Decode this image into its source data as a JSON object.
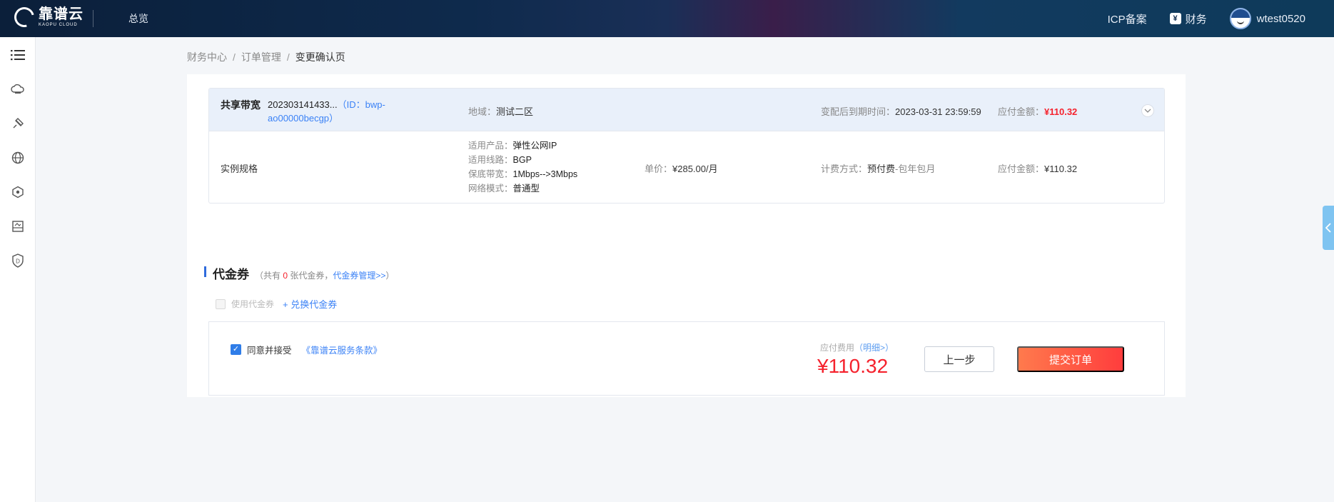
{
  "header": {
    "logo_cn": "靠谱云",
    "logo_en": "KAOPU CLOUD",
    "nav_overview": "总览",
    "icp": "ICP备案",
    "finance_icon": "¥",
    "finance": "财务",
    "username": "wtest0520"
  },
  "sidebar": {
    "icons": [
      "list-icon",
      "cloud-host-icon",
      "satellite-icon",
      "globe-icon",
      "network-node-icon",
      "storage-icon",
      "shield-d-icon"
    ]
  },
  "breadcrumb": {
    "items": [
      "财务中心",
      "订单管理",
      "变更确认页"
    ],
    "separator": "/"
  },
  "order": {
    "type": "共享带宽",
    "order_no": "202303141433...",
    "id_text": "（ID：bwp-ao00000becgp）",
    "region_label": "地域：",
    "region": "测试二区",
    "expire_label": "变配后到期时间：",
    "expire": "2023-03-31 23:59:59",
    "pay_label": "应付金额：",
    "pay_amount": "¥110.32",
    "spec_label": "实例规格",
    "specs": [
      {
        "label": "适用产品：",
        "value": "弹性公网IP"
      },
      {
        "label": "适用线路：",
        "value": "BGP"
      },
      {
        "label": "保底带宽：",
        "value": "1Mbps-->3Mbps"
      },
      {
        "label": "网络模式：",
        "value": "普通型"
      }
    ],
    "unit_price_label": "单价：",
    "unit_price": "¥285.00/月",
    "billing_label": "计费方式：",
    "billing_main": "预付费",
    "billing_sub": "-包年包月",
    "spec_pay_label": "应付金额：",
    "spec_pay": "¥110.32"
  },
  "voucher": {
    "title": "代金券",
    "sub_prefix": "（共有 ",
    "count": "0",
    "sub_mid": " 张代金券，",
    "manage_link": "代金券管理>>",
    "sub_suffix": "）",
    "use_label": "使用代金券",
    "exchange": "+ 兑换代金券"
  },
  "confirm": {
    "agree": "同意并接受",
    "terms": "《靠谱云服务条款》",
    "fee_label": "应付费用",
    "detail_link": "（明细>）",
    "fee_amount": "¥110.32",
    "prev_button": "上一步",
    "submit_button": "提交订单",
    "checkbox_mark": "✓"
  },
  "colors": {
    "accent": "#2f7de8",
    "price_red": "#f5222d",
    "submit_start": "#ff7a4d",
    "submit_end": "#ff3d3d"
  }
}
